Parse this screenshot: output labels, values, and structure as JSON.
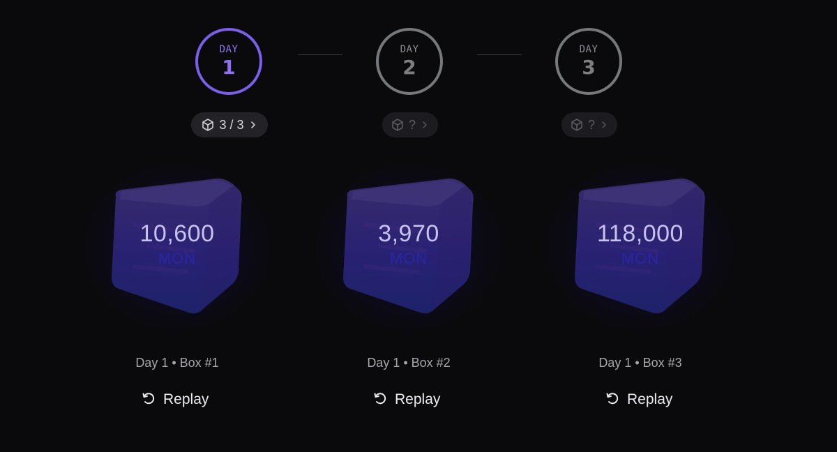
{
  "days": [
    {
      "label": "DAY",
      "number": "1",
      "count_text": "3 / 3",
      "active": true
    },
    {
      "label": "DAY",
      "number": "2",
      "count_text": "?",
      "active": false
    },
    {
      "label": "DAY",
      "number": "3",
      "count_text": "?",
      "active": false
    }
  ],
  "boxes": [
    {
      "amount": "10,600",
      "unit": "MON",
      "caption": "Day 1 • Box #1",
      "replay_label": "Replay"
    },
    {
      "amount": "3,970",
      "unit": "MON",
      "caption": "Day 1 • Box #2",
      "replay_label": "Replay"
    },
    {
      "amount": "118,000",
      "unit": "MON",
      "caption": "Day 1 • Box #3",
      "replay_label": "Replay"
    }
  ],
  "colors": {
    "background": "#0a0a0d",
    "active_accent": "#7b5fe9",
    "inactive_ring": "#77787c",
    "unit_text": "#2a24a8"
  },
  "icons": {
    "pill_icon": "cube-icon",
    "pill_arrow": "chevron-right-icon",
    "replay_icon": "replay-icon"
  }
}
